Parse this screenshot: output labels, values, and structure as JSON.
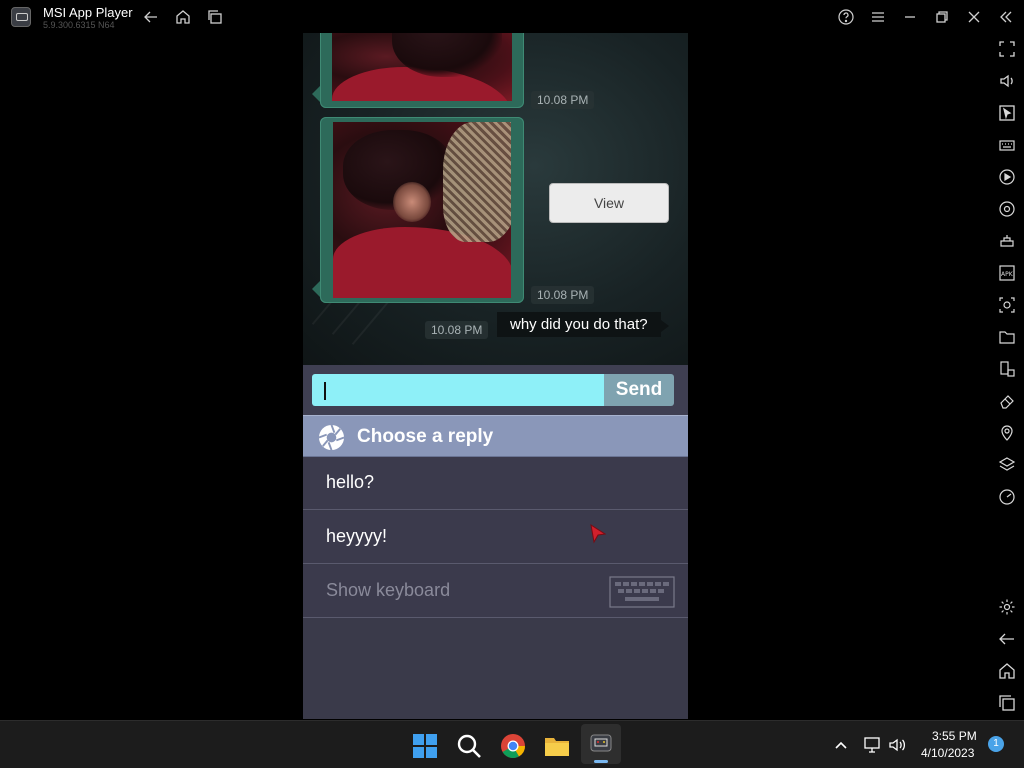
{
  "window": {
    "title": "MSI App Player",
    "version": "5.9.300.6315 N64"
  },
  "chat": {
    "timestamps": [
      "10.08 PM",
      "10.08 PM",
      "10.08 PM"
    ],
    "view_button_label": "View",
    "message": "why did you do that?"
  },
  "input": {
    "value": "",
    "send_label": "Send"
  },
  "replies": {
    "header": "Choose a reply",
    "options": [
      "hello?",
      "heyyyy!"
    ],
    "show_keyboard": "Show keyboard"
  },
  "taskbar": {
    "time": "3:55 PM",
    "date": "4/10/2023",
    "notification_count": "1"
  },
  "colors": {
    "input_bg": "#8ef0f8",
    "send_bg": "#7fa3b0",
    "reply_header_bg": "#8a97b9",
    "reply_list_bg": "#3b3a4c"
  }
}
